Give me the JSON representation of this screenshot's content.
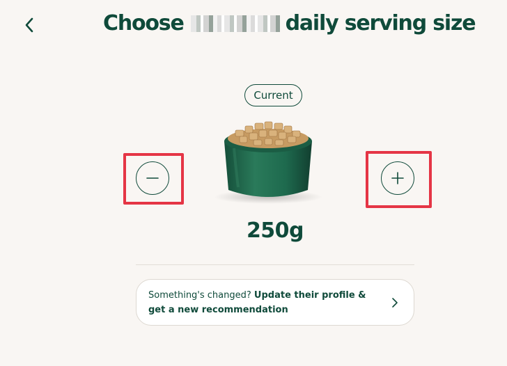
{
  "header": {
    "back_icon": "chevron-left-icon",
    "title_prefix": "Choose",
    "title_suffix": "daily serving size"
  },
  "selector": {
    "badge_label": "Current",
    "amount": "250g",
    "decrease_icon": "minus-icon",
    "increase_icon": "plus-icon"
  },
  "update_card": {
    "lead_text": "Something's changed?",
    "link_text": "Update their profile & get a new recommendation",
    "chevron_icon": "chevron-right-icon"
  },
  "colors": {
    "brand_green": "#0f4a3a",
    "bowl_green": "#1e6a4e",
    "background": "#f9f6f3",
    "highlight_red": "#e53545"
  }
}
